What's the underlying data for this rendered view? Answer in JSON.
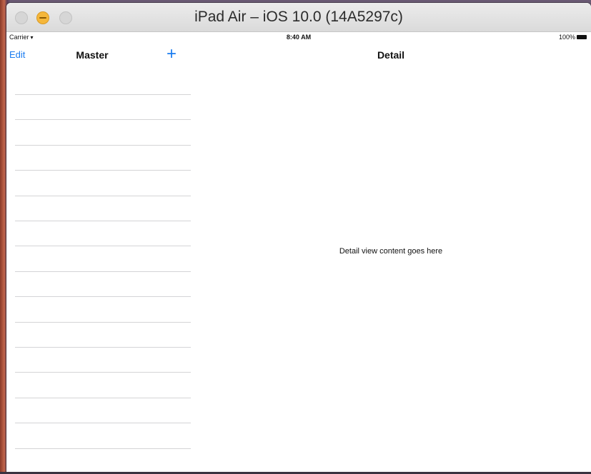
{
  "window": {
    "title": "iPad Air – iOS 10.0 (14A5297c)"
  },
  "status_bar": {
    "carrier": "Carrier",
    "wifi_icon": "wifi-icon",
    "time": "8:40 AM",
    "battery": "100%"
  },
  "master": {
    "edit_label": "Edit",
    "title": "Master",
    "add_label": "+",
    "row_count": 15
  },
  "detail": {
    "title": "Detail",
    "content_text": "Detail view content goes here"
  },
  "colors": {
    "tint": "#1a7cf0",
    "separator": "#d4d4d6",
    "minimize": "#f5b73b"
  }
}
